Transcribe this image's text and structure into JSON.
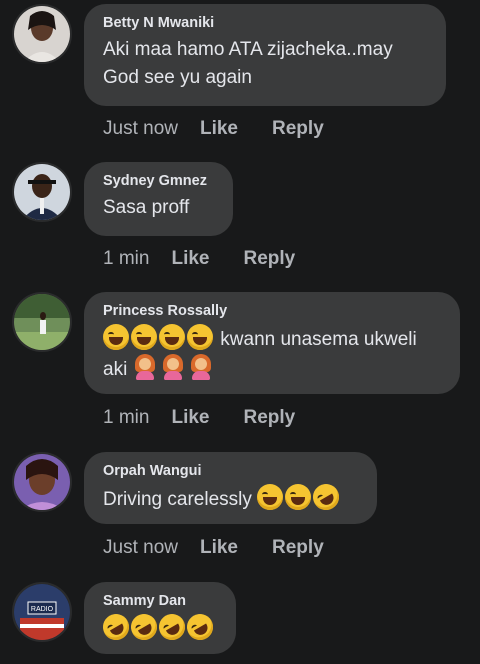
{
  "comments": [
    {
      "author": "Betty N Mwaniki",
      "text_line1": "Aki maa hamo ATA zijacheka..may",
      "text_line2": "God see yu again",
      "time": "Just now",
      "like": "Like",
      "reply": "Reply"
    },
    {
      "author": "Sydney Gmnez",
      "text": "Sasa proff",
      "time": "1 min",
      "like": "Like",
      "reply": "Reply"
    },
    {
      "author": "Princess Rossally",
      "text_after_emoji": "kwann unasema ukweli",
      "text_line2": "aki",
      "time": "1 min",
      "like": "Like",
      "reply": "Reply"
    },
    {
      "author": "Orpah Wangui",
      "text": "Driving carelessly",
      "time": "Just now",
      "like": "Like",
      "reply": "Reply"
    },
    {
      "author": "Sammy Dan"
    }
  ],
  "colors": {
    "background": "#18191a",
    "bubble": "#3a3b3c",
    "text": "#e4e6eb",
    "secondary": "#b0b3b8"
  },
  "icons": {
    "laugh": "face-with-tears-of-joy-icon",
    "rofl": "rolling-on-floor-laughing-icon",
    "woman": "woman-facepalming-icon"
  }
}
